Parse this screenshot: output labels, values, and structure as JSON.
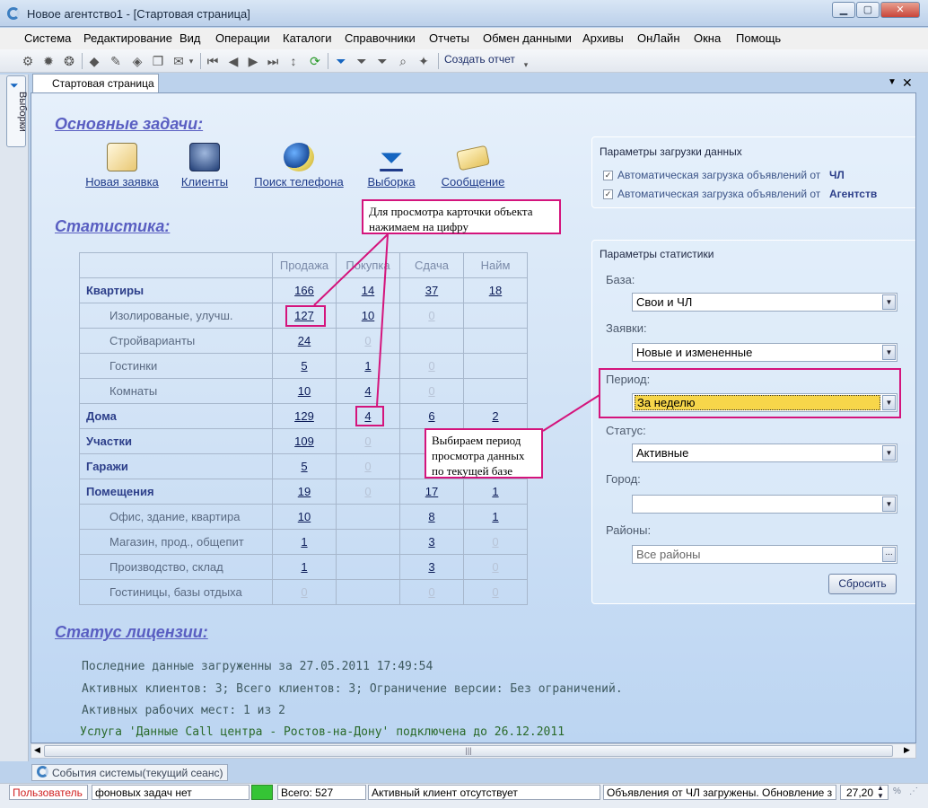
{
  "window": {
    "title": "Новое агентство1 - [Стартовая страница]"
  },
  "menu": [
    "Система",
    "Редактирование",
    "Вид",
    "Операции",
    "Каталоги",
    "Справочники",
    "Отчеты",
    "Обмен данными",
    "Архивы",
    "ОнЛайн",
    "Окна",
    "Помощь"
  ],
  "toolbar": {
    "create_report": "Создать отчет"
  },
  "sidebar": {
    "tab_label": "Выборки"
  },
  "doc_tab": {
    "label": "Стартовая страница"
  },
  "sections": {
    "tasks": "Основные задачи:",
    "statistics": "Статистика:",
    "license": "Статус лицензии:"
  },
  "tasks": [
    {
      "label": "Новая заявка",
      "icon": "new-request-icon"
    },
    {
      "label": "Клиенты",
      "icon": "clients-icon"
    },
    {
      "label": "Поиск телефона",
      "icon": "phone-search-icon"
    },
    {
      "label": "Выборка",
      "icon": "filter-icon"
    },
    {
      "label": "Сообщение",
      "icon": "message-icon"
    }
  ],
  "stats": {
    "headers": [
      "Продажа",
      "Покупка",
      "Сдача",
      "Найм"
    ],
    "rows": [
      {
        "label": "Квартиры",
        "bold": true,
        "v": [
          "166",
          "14",
          "37",
          "18"
        ]
      },
      {
        "label": "Изолированые, улучш.",
        "v": [
          "127",
          "10",
          "0",
          ""
        ]
      },
      {
        "label": "Стройварианты",
        "v": [
          "24",
          "0",
          "",
          ""
        ]
      },
      {
        "label": "Гостинки",
        "v": [
          "5",
          "1",
          "0",
          ""
        ]
      },
      {
        "label": "Комнаты",
        "v": [
          "10",
          "4",
          "0",
          ""
        ]
      },
      {
        "label": "Дома",
        "bold": true,
        "v": [
          "129",
          "4",
          "6",
          "2"
        ]
      },
      {
        "label": "Участки",
        "bold": true,
        "v": [
          "109",
          "0",
          "",
          ""
        ]
      },
      {
        "label": "Гаражи",
        "bold": true,
        "v": [
          "5",
          "0",
          "",
          ""
        ]
      },
      {
        "label": "Помещения",
        "bold": true,
        "v": [
          "19",
          "0",
          "17",
          "1"
        ]
      },
      {
        "label": "Офис, здание, квартира",
        "v": [
          "10",
          "",
          "8",
          "1"
        ]
      },
      {
        "label": "Магазин, прод., общепит",
        "v": [
          "1",
          "",
          "3",
          "0"
        ]
      },
      {
        "label": "Производство, склад",
        "v": [
          "1",
          "",
          "3",
          "0"
        ]
      },
      {
        "label": "Гостиницы, базы отдыха",
        "v": [
          "0",
          "",
          "0",
          "0"
        ]
      }
    ]
  },
  "callouts": {
    "card": "Для просмотра карточки объекта нажимаем на цифру",
    "period": "Выбираем период просмотра данных по текущей базе"
  },
  "load_params": {
    "title": "Параметры загрузки данных",
    "opt1_text": "Автоматическая загрузка объявлений от",
    "opt1_src": "ЧЛ",
    "opt2_text": "Автоматическая загрузка объявлений от",
    "opt2_src": "Агентств"
  },
  "stat_params": {
    "title": "Параметры статистики",
    "base_label": "База:",
    "base_value": "Свои и ЧЛ",
    "requests_label": "Заявки:",
    "requests_value": "Новые и измененные",
    "period_label": "Период:",
    "period_value": "За неделю",
    "status_label": "Статус:",
    "status_value": "Активные",
    "city_label": "Город:",
    "city_value": "",
    "districts_label": "Районы:",
    "districts_value": "Все районы",
    "reset": "Сбросить"
  },
  "license": [
    "Последние данные загруженны за 27.05.2011 17:49:54",
    "Активных клиентов: 3; Всего клиентов:  3; Ограничение версии: Без ограничений.",
    "Активных рабочих мест: 1 из 2",
    "Услуга 'Данные Call центра - Ростов-на-Дону' подключена до 26.12.2011"
  ],
  "bottom_tab": "События системы(текущий сеанс)",
  "status": {
    "user": "Пользователь",
    "tasks": "фоновых задач нет",
    "total": "Всего: 527",
    "client": "Активный клиент отсутствует",
    "update": "Объявления от ЧЛ загружены. Обновление з",
    "zoom": "27,20",
    "pct": "%"
  },
  "colors": {
    "accent": "#5a5fc2",
    "callout_border": "#d4147c",
    "period_highlight": "#f7d64a"
  }
}
